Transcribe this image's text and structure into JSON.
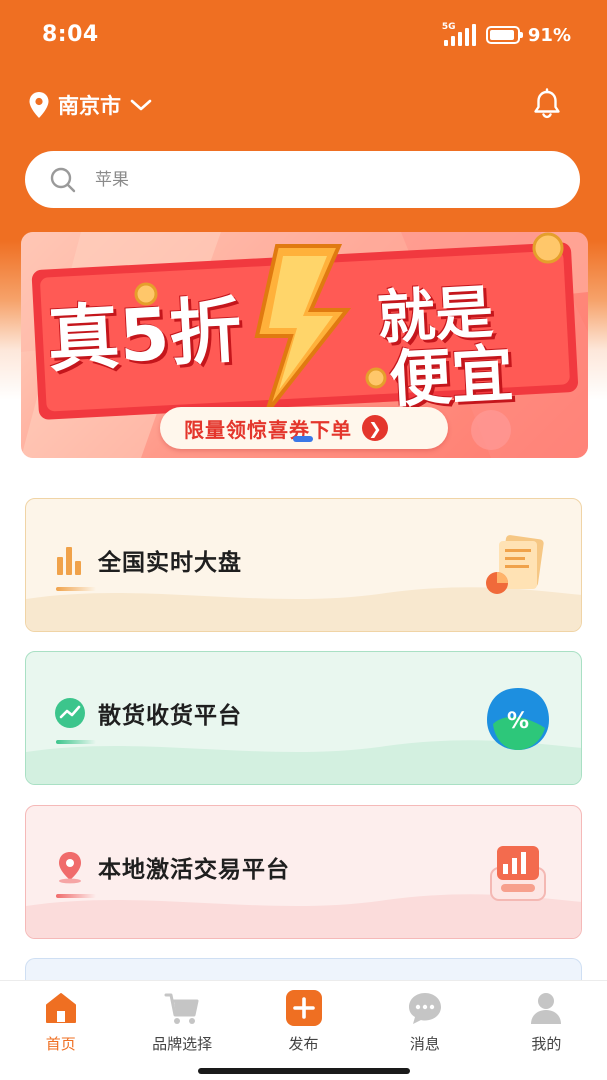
{
  "status_bar": {
    "time": "8:04",
    "network": "5G",
    "battery": "91%",
    "battery_level": 0.91
  },
  "header": {
    "location_icon": "location-pin-icon",
    "city": "南京市",
    "dropdown_icon": "chevron-down-icon",
    "notification_icon": "bell-icon"
  },
  "search": {
    "icon": "search-icon",
    "placeholder": "苹果"
  },
  "banner": {
    "title_left": "真5折",
    "title_right_line1": "就是",
    "title_right_line2": "便宜",
    "cta": "限量领惊喜券下单",
    "cta_icon": "chevron-right-icon"
  },
  "cards": [
    {
      "title": "全国实时大盘",
      "icon": "bar-chart-icon",
      "illustration": "document-chart-illustration",
      "accent": "#f0a24a"
    },
    {
      "title": "散货收货平台",
      "icon": "trend-line-icon",
      "illustration": "percent-badge-illustration",
      "accent": "#3cc58c"
    },
    {
      "title": "本地激活交易平台",
      "icon": "map-pin-icon",
      "illustration": "trading-box-illustration",
      "accent": "#f06b6b"
    }
  ],
  "tabbar": {
    "items": [
      {
        "label": "首页",
        "icon": "home-icon",
        "active": true
      },
      {
        "label": "品牌选择",
        "icon": "cart-icon",
        "active": false
      },
      {
        "label": "发布",
        "icon": "plus-icon",
        "active": false
      },
      {
        "label": "消息",
        "icon": "chat-icon",
        "active": false
      },
      {
        "label": "我的",
        "icon": "user-icon",
        "active": false
      }
    ]
  },
  "colors": {
    "brand": "#ef6f22",
    "active_tab": "#ef6f22",
    "inactive_icon": "#c5c5c5"
  }
}
